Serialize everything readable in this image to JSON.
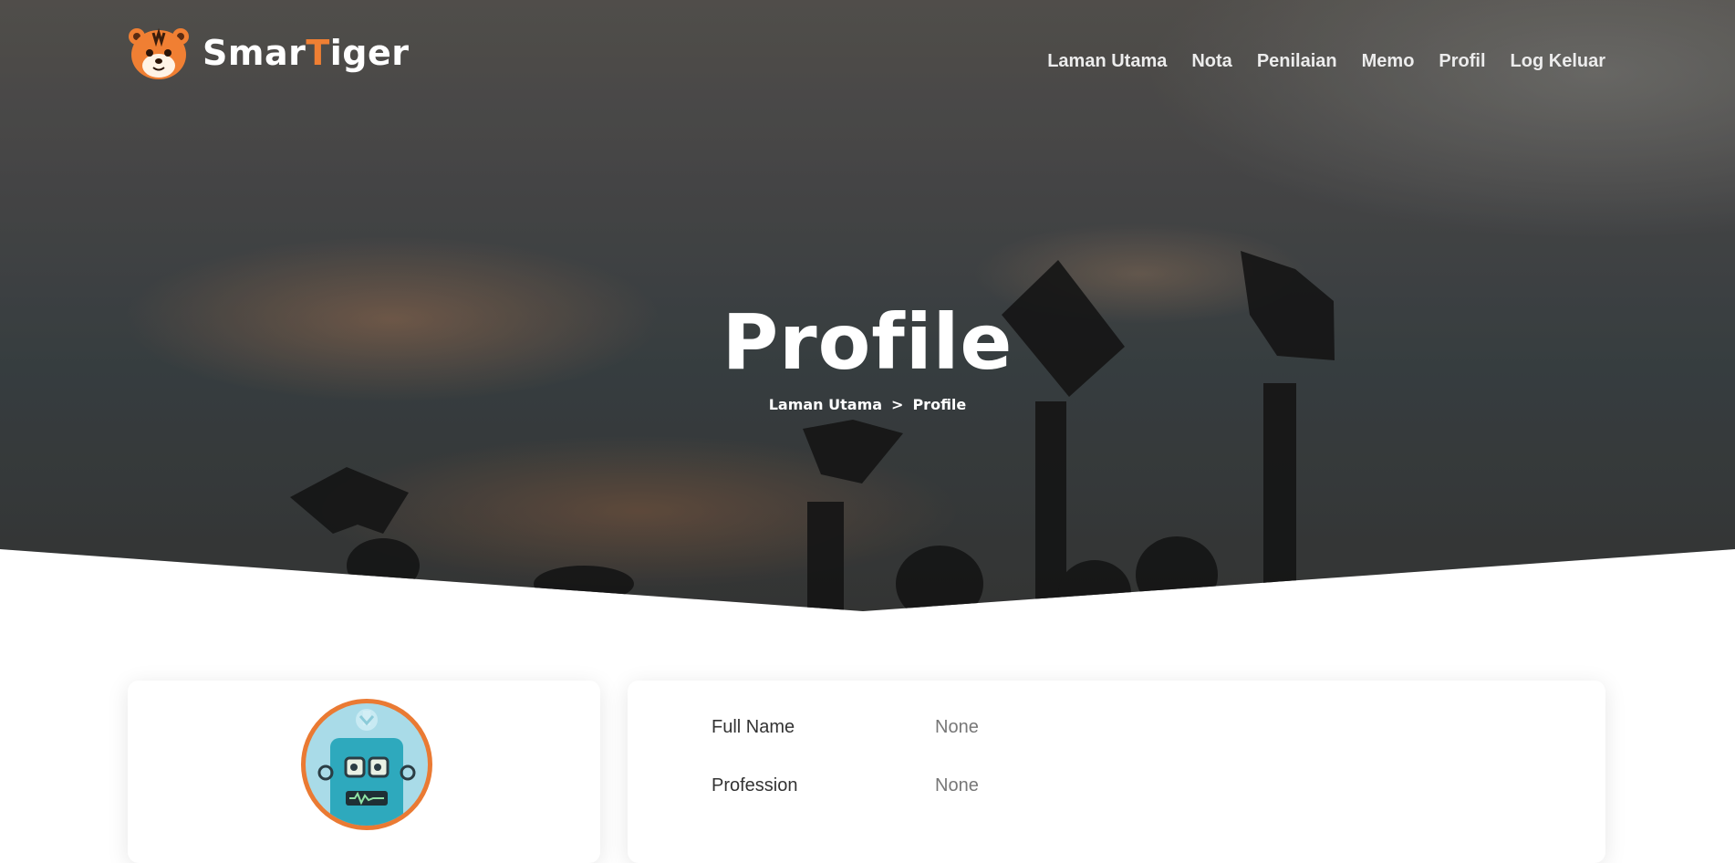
{
  "brand": {
    "name_part1": "Smar",
    "name_accent": "T",
    "name_part2": "iger"
  },
  "nav": {
    "items": [
      {
        "label": "Laman Utama"
      },
      {
        "label": "Nota"
      },
      {
        "label": "Penilaian"
      },
      {
        "label": "Memo"
      },
      {
        "label": "Profil"
      },
      {
        "label": "Log Keluar"
      }
    ]
  },
  "hero": {
    "title": "Profile",
    "breadcrumb": {
      "home": "Laman Utama",
      "separator": ">",
      "current": "Profile"
    }
  },
  "profile": {
    "fields": [
      {
        "label": "Full Name",
        "value": "None"
      },
      {
        "label": "Profession",
        "value": "None"
      }
    ]
  },
  "colors": {
    "accent": "#f07f33",
    "avatar_border": "#ea7a33",
    "avatar_bg": "#a9dbe8"
  },
  "icons": {
    "logo": "tiger-logo-icon",
    "avatar": "robot-avatar-icon"
  }
}
